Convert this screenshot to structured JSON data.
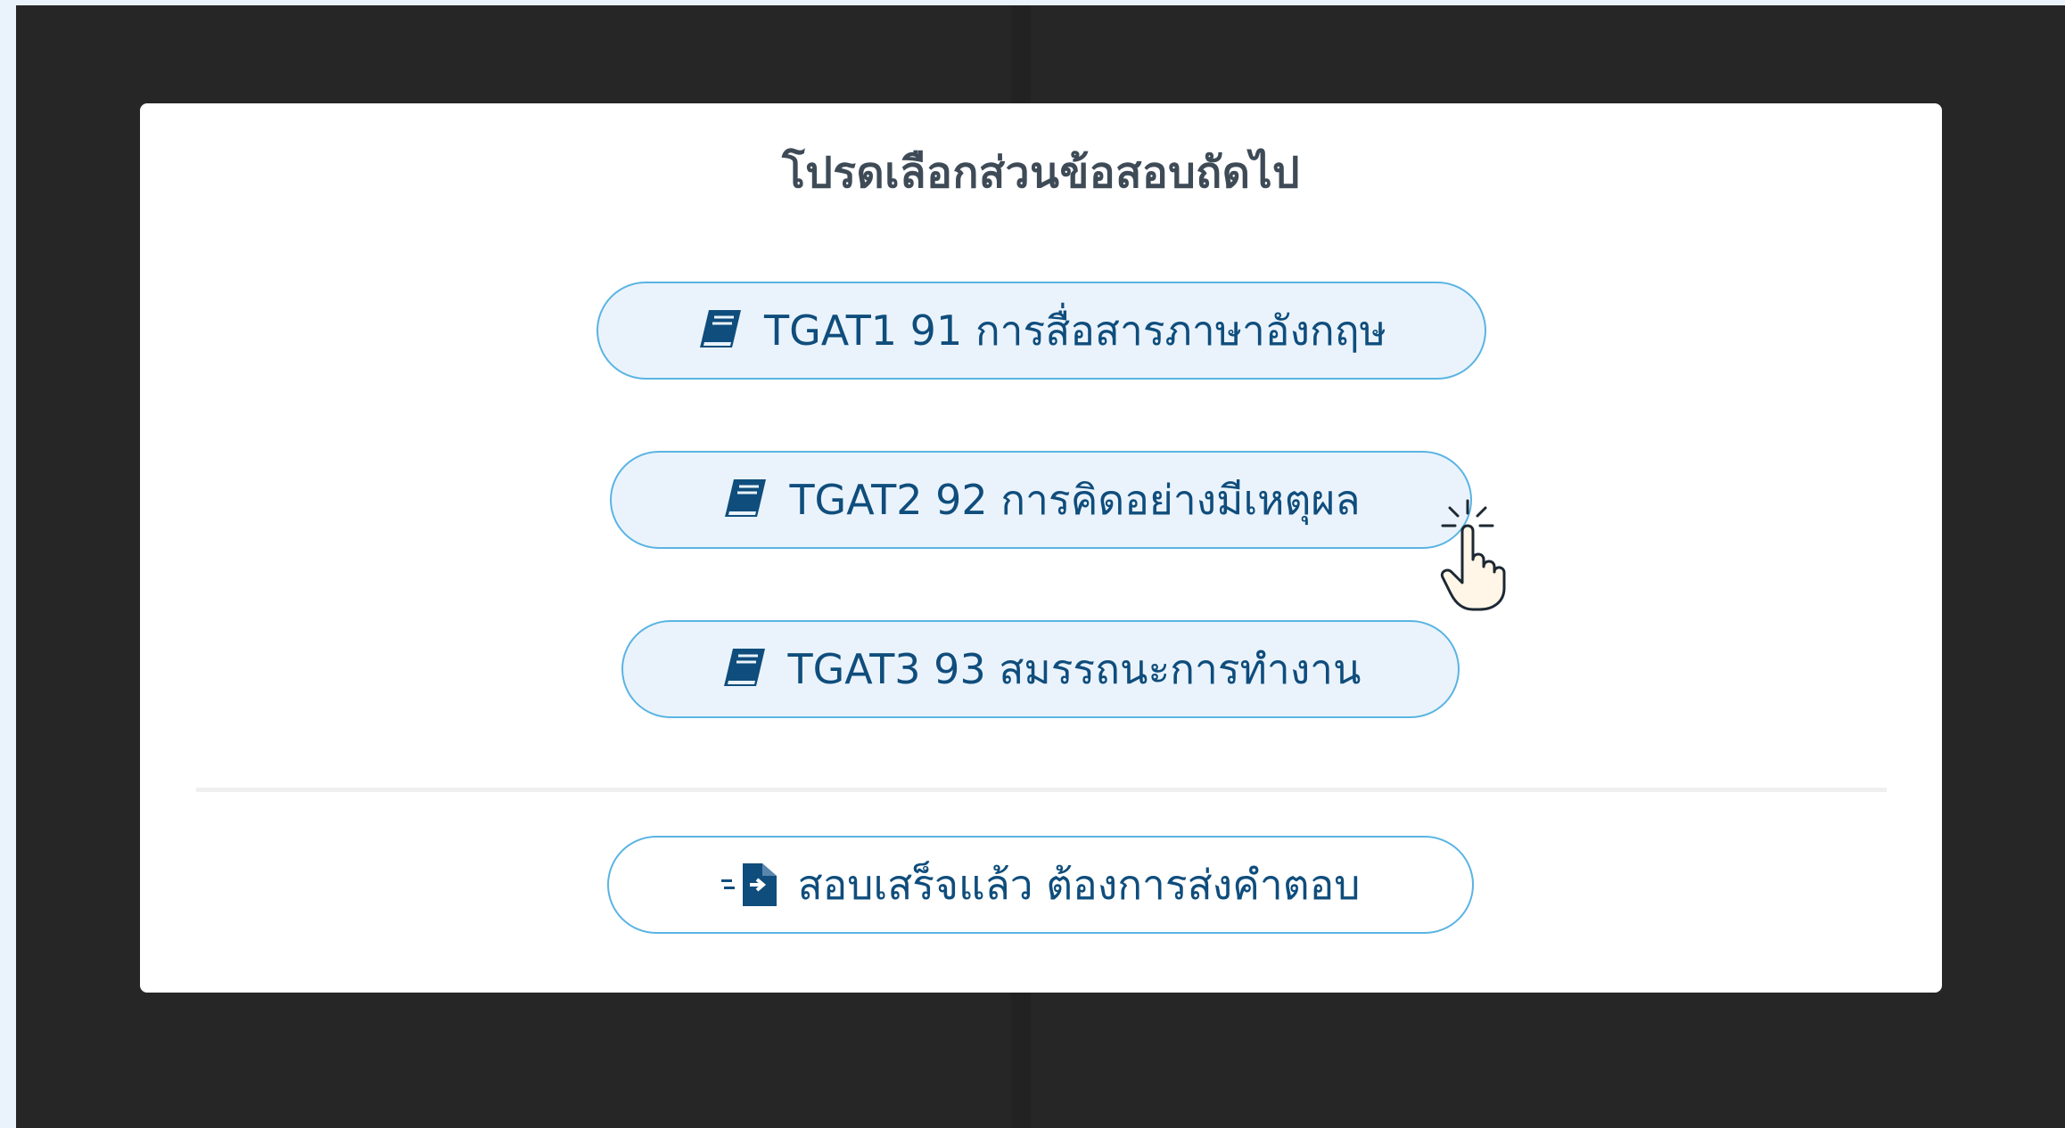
{
  "modal": {
    "title": "โปรดเลือกส่วนข้อสอบถัดไป",
    "sections": [
      {
        "label": "TGAT1 91 การสื่อสารภาษาอังกฤษ",
        "icon": "book-icon"
      },
      {
        "label": "TGAT2 92 การคิดอย่างมีเหตุผล",
        "icon": "book-icon"
      },
      {
        "label": "TGAT3 93 สมรรถนะการทำงาน",
        "icon": "book-icon"
      }
    ],
    "submit": {
      "label": "สอบเสร็จแล้ว ต้องการส่งคำตอบ",
      "icon": "file-export-icon"
    }
  },
  "colors": {
    "accent": "#5ab4e3",
    "text": "#0f4d7c",
    "button_bg": "#eaf3fc",
    "title": "#3e4b57",
    "backdrop": "#262626"
  }
}
